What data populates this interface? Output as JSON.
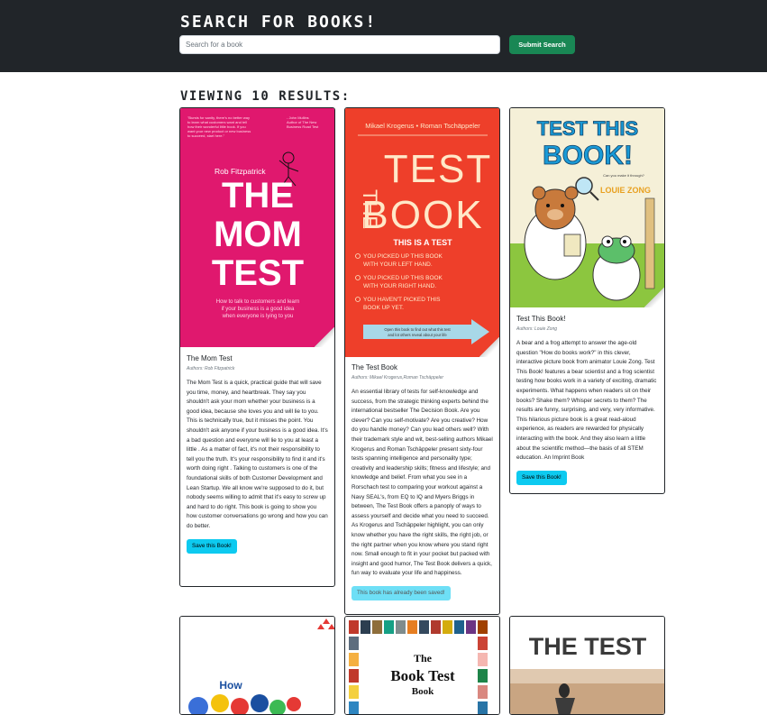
{
  "header": {
    "title": "SEARCH FOR BOOKS!",
    "search_placeholder": "Search for a book",
    "search_value": "",
    "submit_label": "Submit Search",
    "colors": {
      "background": "#212529",
      "submit": "#198754"
    }
  },
  "results": {
    "heading": "VIEWING 10 RESULTS:",
    "books": [
      {
        "cover": {
          "quote": "\"Bursts for sanity, there's no better way to learn what customers want and tell how their wonderful little book. If you want your new product or new business to succeed, start here.\"",
          "quote_author": "John Mullins",
          "quote_role": "Author of The New Business Road Test",
          "author": "Rob Fitzpatrick",
          "title_lines": [
            "THE",
            "MOM",
            "TEST"
          ],
          "subtitle": "How to talk to customers and learn if your business is a good idea when everyone is lying to you",
          "color": "#e0186e"
        },
        "title": "The Mom Test",
        "authors": "Authors: Rob Fitzpatrick",
        "description": "The Mom Test is a quick, practical guide that will save you time, money, and heartbreak. They say you shouldn't ask your mom whether your business is a good idea, because she loves you and will lie to you. This is technically true, but it misses the point. You shouldn't ask anyone if your business is a good idea. It's a bad question and everyone will lie to you at least a little . As a matter of fact, it's not their responsibility to tell you the truth. It's your responsibility to find it and it's worth doing right . Talking to customers is one of the foundational skills of both Customer Development and Lean Startup. We all know we're supposed to do it, but nobody seems willing to admit that it's easy to screw up and hard to do right. This book is going to show you how customer conversations go wrong and how you can do better.",
        "button_label": "Save this Book!",
        "saved": false
      },
      {
        "cover": {
          "author": "Mikael Krogerus • Roman Tschäppeler",
          "title_lines": [
            "THE",
            "TEST",
            "BOOK"
          ],
          "tagline": "THIS IS A TEST",
          "checklist": [
            "YOU PICKED UP THIS BOOK WITH YOUR LEFT HAND.",
            "YOU PICKED UP THIS BOOK WITH YOUR RIGHT HAND.",
            "YOU HAVEN'T PICKED THIS BOOK UP YET."
          ],
          "arrow_text": "Open this book to find out what this test and lot others reveal about your life",
          "color": "#ee3f2a"
        },
        "title": "The Test Book",
        "authors": "Authors: Mikael Krogerus,Roman Tschäppeler",
        "description": "An essential library of tests for self-knowledge and success, from the strategic thinking experts behind the international bestseller The Decision Book. Are you clever? Can you self-motivate? Are you creative? How do you handle money? Can you lead others well? With their trademark style and wit, best-selling authors Mikael Krogerus and Roman Tschäppeler present sixty-four tests spanning intelligence and personality type; creativity and leadership skills; fitness and lifestyle; and knowledge and belief. From what you see in a Rorschach test to comparing your workout against a Navy SEAL's, from EQ to IQ and Myers Briggs in between, The Test Book offers a panoply of ways to assess yourself and decide what you need to succeed. As Krogerus and Tschäppeler highlight, you can only know whether you have the right skills, the right job, or the right partner when you know where you stand right now. Small enough to fit in your pocket but packed with insight and good humor, The Test Book delivers a quick, fun way to evaluate your life and happiness.",
        "button_label": "This book has already been saved!",
        "saved": true
      },
      {
        "cover": {
          "title_lines": [
            "TEST THIS",
            "BOOK!"
          ],
          "author": "LOUIE ZONG",
          "small_text": "Can you make it through?",
          "color": "#f5f0d8"
        },
        "title": "Test This Book!",
        "authors": "Authors: Louie Zong",
        "description": "A bear and a frog attempt to answer the age-old question \"How do books work?\" in this clever, interactive picture book from animator Louie Zong. Test This Book! features a bear scientist and a frog scientist testing how books work in a variety of exciting, dramatic experiments. What happens when readers sit on their books? Shake them? Whisper secrets to them? The results are funny, surprising, and very, very informative. This hilarious picture book is a great read-aloud experience, as readers are rewarded for physically interacting with the book. And they also learn a little about the scientific method—the basis of all STEM education. An Imprint Book",
        "button_label": "Save this Book!",
        "saved": false
      },
      {
        "cover": {
          "title_lines": [
            "How"
          ]
        }
      },
      {
        "cover": {
          "title_lines": [
            "The",
            "Book Test",
            "Book"
          ]
        }
      },
      {
        "cover": {
          "title_lines": [
            "THE TEST"
          ]
        }
      }
    ]
  }
}
